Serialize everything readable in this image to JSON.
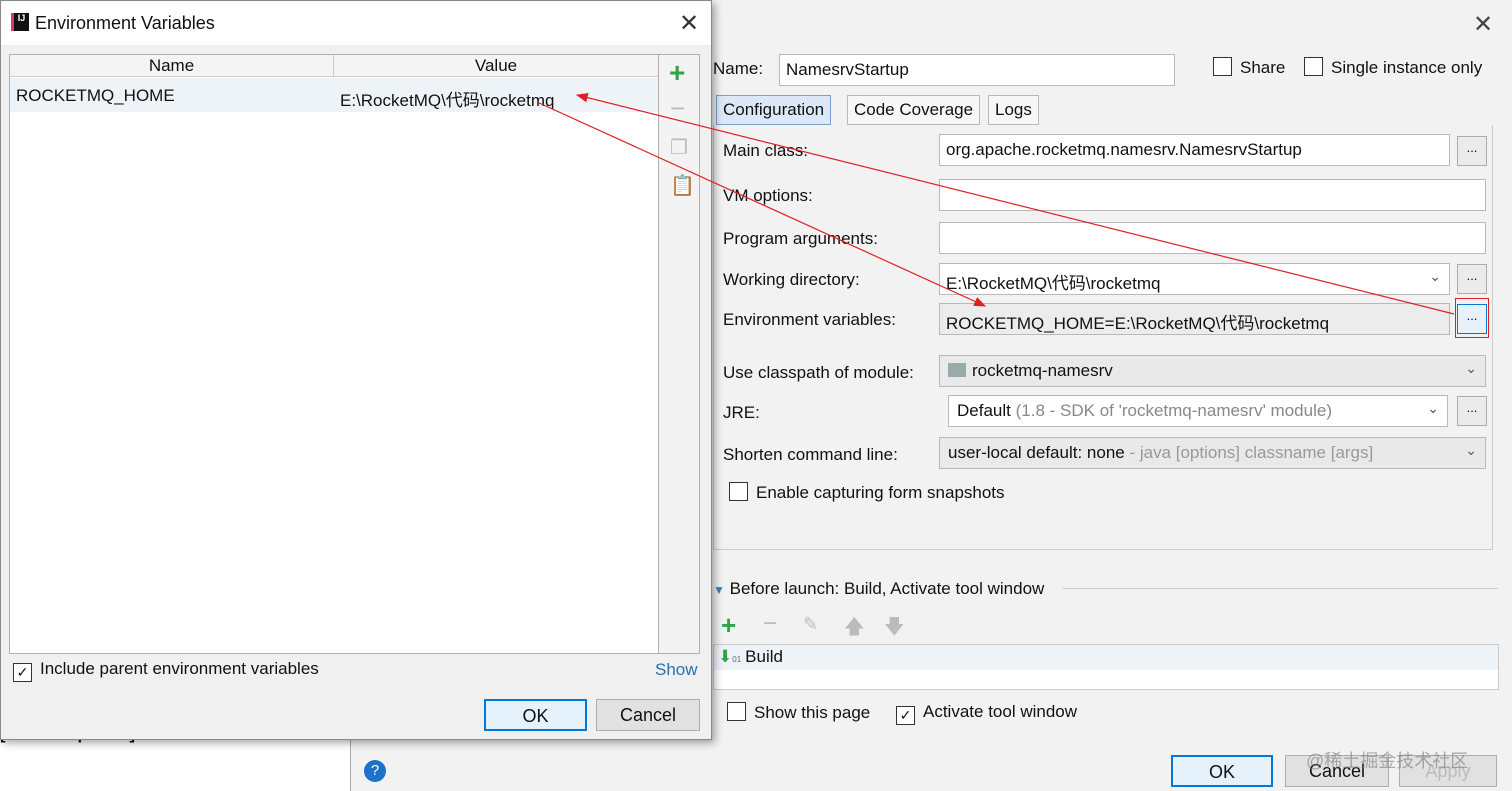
{
  "background": {
    "text": "[rocketmq-store]"
  },
  "run_config": {
    "name_label": "Name:",
    "name_value": "NamesrvStartup",
    "share_label": "Share",
    "single_instance_label": "Single instance only",
    "share_checked": false,
    "single_instance_checked": false,
    "tabs": [
      {
        "label": "Configuration",
        "active": true
      },
      {
        "label": "Code Coverage"
      },
      {
        "label": "Logs"
      }
    ],
    "main_class_label": "Main class:",
    "main_class_value": "org.apache.rocketmq.namesrv.NamesrvStartup",
    "vm_options_label": "VM options:",
    "vm_options_value": "",
    "program_args_label": "Program arguments:",
    "program_args_value": "",
    "working_dir_label": "Working directory:",
    "working_dir_value": "E:\\RocketMQ\\代码\\rocketmq",
    "env_vars_label": "Environment variables:",
    "env_vars_value": "ROCKETMQ_HOME=E:\\RocketMQ\\代码\\rocketmq",
    "classpath_label": "Use classpath of module:",
    "classpath_value": "rocketmq-namesrv",
    "jre_label": "JRE:",
    "jre_value": "Default",
    "jre_hint": "(1.8 - SDK of 'rocketmq-namesrv' module)",
    "shorten_label": "Shorten command line:",
    "shorten_value": "user-local default: none",
    "shorten_hint": " - java [options] classname [args]",
    "capture_label": "Enable capturing form snapshots",
    "capture_checked": false,
    "before_launch_label": "Before launch: Build, Activate tool window",
    "before_launch_items": [
      "Build"
    ],
    "show_page_label": "Show this page",
    "show_page_checked": false,
    "activate_label": "Activate tool window",
    "activate_checked": true,
    "ok": "OK",
    "cancel": "Cancel",
    "apply": "Apply",
    "ellipsis": "...",
    "watermark": "@稀土掘金技术社区"
  },
  "env_dialog": {
    "title": "Environment Variables",
    "columns": [
      "Name",
      "Value"
    ],
    "rows": [
      {
        "name": "ROCKETMQ_HOME",
        "value": "E:\\RocketMQ\\代码\\rocketmq"
      }
    ],
    "include_parent_label": "Include parent environment variables",
    "include_parent_checked": true,
    "show_link": "Show",
    "ok": "OK",
    "cancel": "Cancel"
  },
  "colors": {
    "accent": "#0078d7",
    "annotation": "#e02020",
    "add_green": "#2fa24a"
  }
}
